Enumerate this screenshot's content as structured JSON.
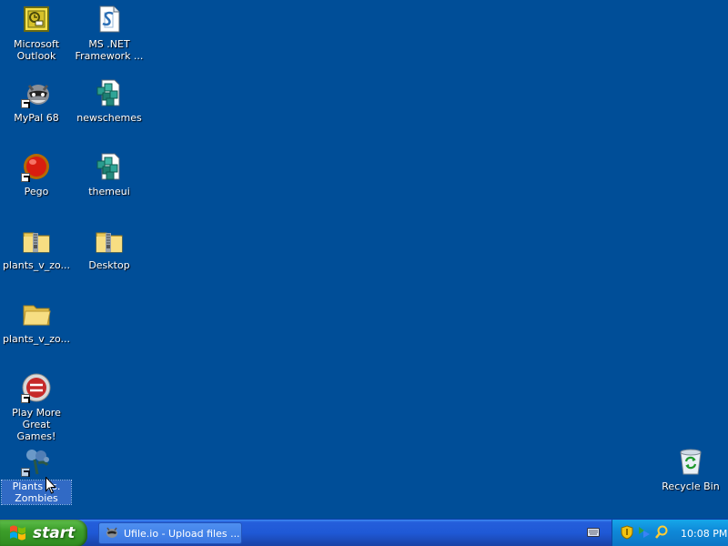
{
  "desktop": {
    "icons": [
      {
        "label": "Microsoft\nOutlook",
        "icon": "outlook-icon"
      },
      {
        "label": "MS .NET\nFramework ...",
        "icon": "dotnet-framework-icon"
      },
      {
        "label": "MyPal 68",
        "icon": "mypal-raccoon-icon"
      },
      {
        "label": "newschemes",
        "icon": "registry-file-icon"
      },
      {
        "label": "Pego",
        "icon": "pego-red-ball-icon"
      },
      {
        "label": "themeui",
        "icon": "registry-file-icon"
      },
      {
        "label": "plants_v_zo...",
        "icon": "zip-folder-icon"
      },
      {
        "label": "Desktop",
        "icon": "zip-folder-icon"
      },
      {
        "label": "plants_v_zo...",
        "icon": "folder-icon"
      },
      {
        "label": "Play More\nGreat Games!",
        "icon": "popcap-icon"
      },
      {
        "label": "Plants vs.\nZombies",
        "icon": "plants-vs-zombies-icon"
      },
      {
        "label": "Recycle Bin",
        "icon": "recycle-bin-icon"
      }
    ]
  },
  "taskbar": {
    "start_label": "start",
    "task_item_label": "Ufile.io - Upload files ...",
    "clock": "10:08 PM"
  },
  "colors": {
    "desktop_bg": "#004e98",
    "taskbar": "#245edb",
    "start_green": "#3c9e2a",
    "tray": "#0f8ad9",
    "selection": "#316ac5"
  }
}
